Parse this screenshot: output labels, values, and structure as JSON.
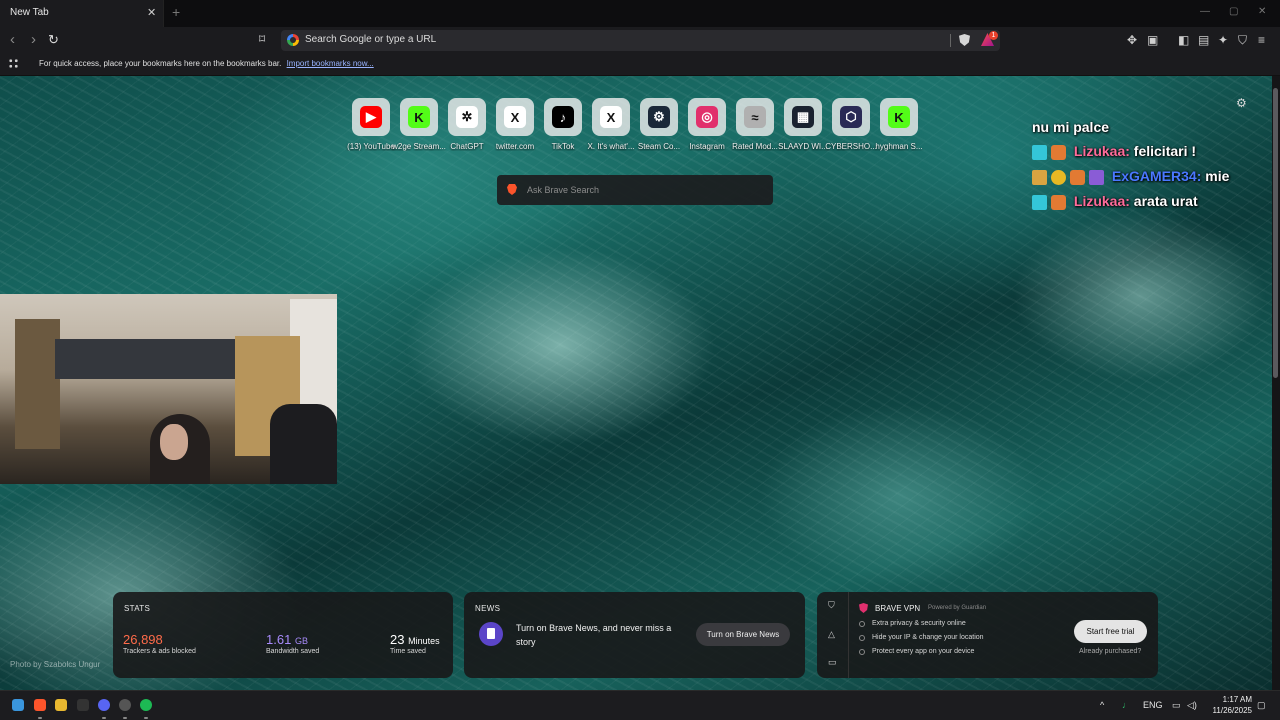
{
  "browser": {
    "tab_title": "New Tab",
    "tab_close": "✕",
    "new_tab": "+",
    "window_controls": {
      "minimize": "—",
      "maximize": "▢",
      "close": "✕"
    },
    "omnibox_text": "Search Google or type a URL",
    "rewards_badge": "1"
  },
  "bookmarks_bar": {
    "message": "For quick access, place your bookmarks here on the bookmarks bar.",
    "import_link": "Import bookmarks now..."
  },
  "top_sites": [
    {
      "label": "(13) YouTube",
      "glyph": "▶",
      "color": "#ff0000",
      "icon": "youtube-icon"
    },
    {
      "label": "w2ge Stream...",
      "glyph": "K",
      "color": "#53fc18",
      "icon": "kick-icon"
    },
    {
      "label": "ChatGPT",
      "glyph": "✲",
      "color": "#ffffff",
      "icon": "chatgpt-icon"
    },
    {
      "label": "twitter.com",
      "glyph": "X",
      "color": "#ffffff",
      "icon": "x-icon"
    },
    {
      "label": "TikTok",
      "glyph": "♪",
      "color": "#000000",
      "icon": "tiktok-icon"
    },
    {
      "label": "X. It's what'...",
      "glyph": "X",
      "color": "#ffffff",
      "icon": "x-icon"
    },
    {
      "label": "Steam Co...",
      "glyph": "⚙",
      "color": "#1b2838",
      "icon": "steam-icon"
    },
    {
      "label": "Instagram",
      "glyph": "◎",
      "color": "#e1306c",
      "icon": "instagram-icon"
    },
    {
      "label": "Rated Mod...",
      "glyph": "≈",
      "color": "#b0b0b0",
      "icon": "rated-icon"
    },
    {
      "label": "SLAAYD WI...",
      "glyph": "▦",
      "color": "#1a2230",
      "icon": "slaayd-icon"
    },
    {
      "label": "CYBERSHO...",
      "glyph": "⬡",
      "color": "#2a2a55",
      "icon": "cybershoke-icon"
    },
    {
      "label": "hyghman S...",
      "glyph": "K",
      "color": "#53fc18",
      "icon": "kick-icon"
    }
  ],
  "brave_search": {
    "placeholder": "Ask Brave Search"
  },
  "chat": [
    {
      "user": "",
      "message": "nu mi palce",
      "color": "#ffffff"
    },
    {
      "user": "Lizukaa:",
      "message": "felicitari !",
      "color": "#ff6b9a"
    },
    {
      "user": "ExGAMER34:",
      "message": "mie",
      "color": "#4a78ff"
    },
    {
      "user": "Lizukaa:",
      "message": "arata urat",
      "color": "#ff6b9a"
    }
  ],
  "photo_credit": "Photo by Szabolcs Ungur",
  "stats": {
    "title": "STATS",
    "trackers_value": "26,898",
    "trackers_label": "Trackers & ads blocked",
    "trackers_color": "#ff6b4a",
    "bandwidth_value": "1.61",
    "bandwidth_unit": "GB",
    "bandwidth_label": "Bandwidth saved",
    "bandwidth_color": "#a78bfa",
    "time_value": "23",
    "time_unit": "Minutes",
    "time_label": "Time saved"
  },
  "news": {
    "title": "NEWS",
    "text": "Turn on Brave News, and never miss a story",
    "button": "Turn on Brave News"
  },
  "vpn": {
    "title": "BRAVE VPN",
    "powered": "Powered by  Guardian",
    "features": [
      "Extra privacy & security online",
      "Hide your IP & change your location",
      "Protect every app on your device"
    ],
    "button": "Start free trial",
    "already": "Already purchased?"
  },
  "taskbar": {
    "language": "ENG",
    "time": "1:17 AM",
    "date": "11/26/2025"
  }
}
